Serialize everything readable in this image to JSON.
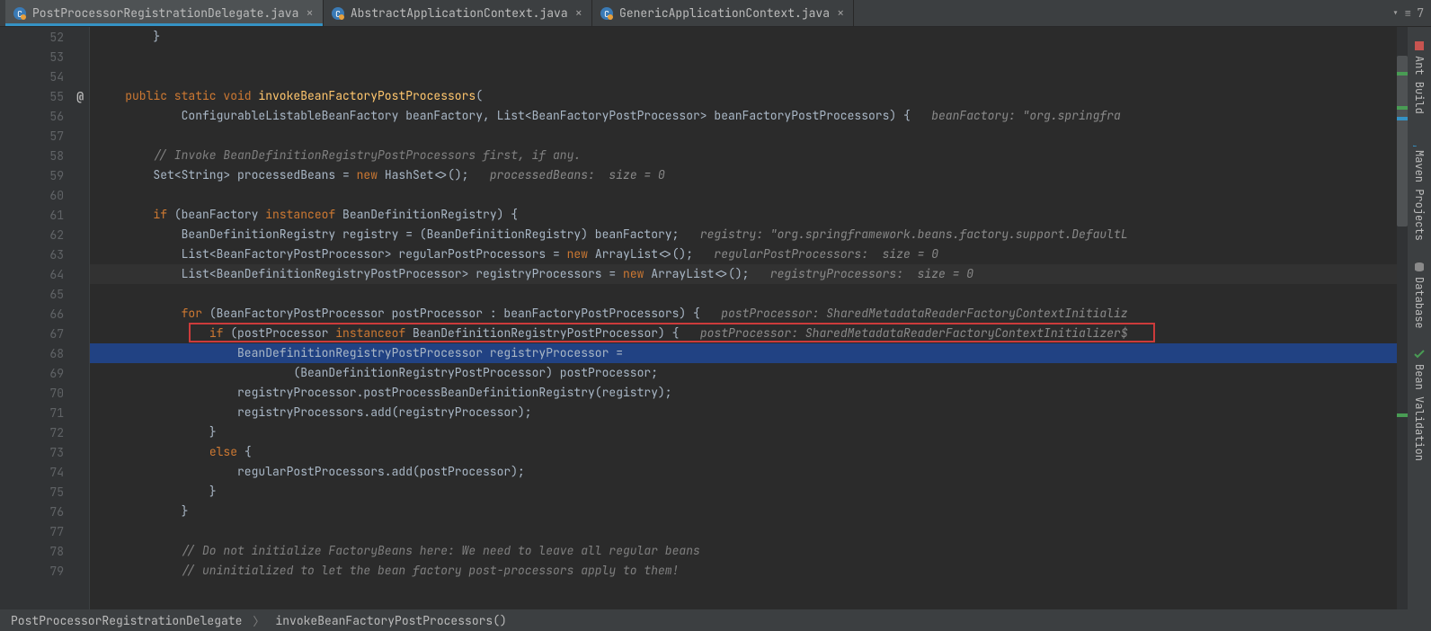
{
  "tabs": [
    {
      "label": "PostProcessorRegistrationDelegate.java",
      "active": true
    },
    {
      "label": "AbstractApplicationContext.java",
      "active": false
    },
    {
      "label": "GenericApplicationContext.java",
      "active": false
    }
  ],
  "tabs_toolbar_count": "7",
  "lines": {
    "start": 52,
    "end": 79
  },
  "code": {
    "l52": "        }",
    "l53": "",
    "l54": "",
    "l55_pre": "    ",
    "l55_kw1": "public static void ",
    "l55_method": "invokeBeanFactoryPostProcessors",
    "l55_post": "(",
    "l56_pre": "            ConfigurableListableBeanFactory beanFactory, List<BeanFactoryPostProcessor> beanFactoryPostProcessors) {   ",
    "l56_hint": "beanFactory: \"org.springfra",
    "l57": "",
    "l58_pre": "        ",
    "l58_comment": "// Invoke BeanDefinitionRegistryPostProcessors first, if any.",
    "l59_pre": "        Set<String> processedBeans = ",
    "l59_kw": "new ",
    "l59_post": "HashSet<>();   ",
    "l59_hint": "processedBeans:  size = 0",
    "l60": "",
    "l61_pre": "        ",
    "l61_kw1": "if ",
    "l61_mid": "(beanFactory ",
    "l61_kw2": "instanceof ",
    "l61_post": "BeanDefinitionRegistry) {",
    "l62_pre": "            BeanDefinitionRegistry registry = (BeanDefinitionRegistry) beanFactory;   ",
    "l62_hint": "registry: \"org.springframework.beans.factory.support.DefaultL",
    "l63_pre": "            List<BeanFactoryPostProcessor> regularPostProcessors = ",
    "l63_kw": "new ",
    "l63_post": "ArrayList<>();   ",
    "l63_hint": "regularPostProcessors:  size = 0",
    "l64_pre": "            List<BeanDefinitionRegistryPostProcessor> registryProcessors = ",
    "l64_kw": "new ",
    "l64_post": "ArrayList<>();   ",
    "l64_hint": "registryProcessors:  size = 0",
    "l65": "",
    "l66_pre": "            ",
    "l66_kw": "for ",
    "l66_post": "(BeanFactoryPostProcessor postProcessor : beanFactoryPostProcessors) {   ",
    "l66_hint": "postProcessor: SharedMetadataReaderFactoryContextInitializ",
    "l67_pre": "                ",
    "l67_kw1": "if ",
    "l67_mid": "(postProcessor ",
    "l67_kw2": "instanceof ",
    "l67_post": "BeanDefinitionRegistryPostProcessor) {   ",
    "l67_hint": "postProcessor: SharedMetadataReaderFactoryContextInitializer$",
    "l68_pre": "                    BeanDefinitionRegistryPostProcessor registryProcessor =",
    "l69_pre": "                            (BeanDefinitionRegistryPostProcessor) postProcessor;",
    "l70_pre": "                    registryProcessor.postProcessBeanDefinitionRegistry(registry);",
    "l71_pre": "                    registryProcessors.add(registryProcessor);",
    "l72_pre": "                }",
    "l73_pre": "                ",
    "l73_kw": "else ",
    "l73_post": "{",
    "l74_pre": "                    regularPostProcessors.add(postProcessor);",
    "l75_pre": "                }",
    "l76_pre": "            }",
    "l77": "",
    "l78_pre": "            ",
    "l78_comment": "// Do not initialize FactoryBeans here: We need to leave all regular beans",
    "l79_pre": "            ",
    "l79_comment": "// uninitialized to let the bean factory post-processors apply to them!"
  },
  "breadcrumbs": {
    "c1": "PostProcessorRegistrationDelegate",
    "c2": "invokeBeanFactoryPostProcessors()"
  },
  "right_tools": {
    "t1": "Ant Build",
    "t2": "Maven Projects",
    "t3": "Database",
    "t4": "Bean Validation"
  }
}
